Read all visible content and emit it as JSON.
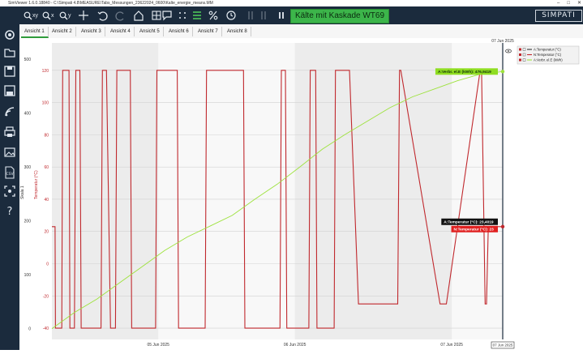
{
  "title_bar": {
    "text": "SimViewer 1.6.0.18840 - C:\\Simpati 4.8\\MEASURE\\Tabs_Messungen_23622024_0600\\Kalte_energie_means.MM"
  },
  "toolbar": {
    "zoom_xy": "xy",
    "zoom_x": "x",
    "zoom_y": "y",
    "kaskade_button": "Kälte mit Kaskade WT69",
    "logo": "SIMPATI"
  },
  "tabs": [
    {
      "label": "Ansicht 1"
    },
    {
      "label": "Ansicht 2"
    },
    {
      "label": "Ansicht 3"
    },
    {
      "label": "Ansicht 4"
    },
    {
      "label": "Ansicht 5"
    },
    {
      "label": "Ansicht 6"
    },
    {
      "label": "Ansicht 7"
    },
    {
      "label": "Ansicht 8"
    }
  ],
  "chart_data": {
    "type": "line",
    "top_date_label": "07 Jun 2025",
    "cursor_date_label": "07 Jun 2025",
    "axes": {
      "scale1": {
        "label": "Skala 1",
        "ticks": [
          "500",
          "400",
          "300",
          "200",
          "100",
          "0"
        ],
        "range": [
          -20,
          530
        ]
      },
      "temperature": {
        "label": "Temperatur (°C)",
        "ticks": [
          "120",
          "100",
          "80",
          "60",
          "40",
          "20",
          "0",
          "-20",
          "-40"
        ],
        "range": [
          -47,
          137
        ]
      }
    },
    "x_ticks": [
      "05 Jun 2025",
      "06 Jun 2025",
      "07 Jun 2025"
    ],
    "legend": [
      {
        "label": "A:Temperatur (°C)",
        "color": "#333333"
      },
      {
        "label": "N:Temperatur (°C)",
        "color": "#c0282d"
      },
      {
        "label": "A:Verbr. el.E (kWh)",
        "color": "#9de23c"
      }
    ],
    "cursor_labels": {
      "verbr": "A:Verbr. el.E (kWh): 476,9419",
      "a_temp": "A:Temperatur (°C): 23,4019",
      "n_temp": "N:Temperatur (°C): 23"
    },
    "series": [
      {
        "name": "N:Temperatur (°C)",
        "color": "#c0282d",
        "x": [
          0.0,
          0.007,
          0.008,
          0.014,
          0.016,
          0.022,
          0.024,
          0.038,
          0.04,
          0.05,
          0.053,
          0.062,
          0.065,
          0.071,
          0.073,
          0.109,
          0.112,
          0.118,
          0.121,
          0.13,
          0.133,
          0.141,
          0.144,
          0.174,
          0.177,
          0.196,
          0.199,
          0.205,
          0.208,
          0.23,
          0.233,
          0.278,
          0.281,
          0.306,
          0.309,
          0.324,
          0.327,
          0.34,
          0.343,
          0.425,
          0.428,
          0.435,
          0.438,
          0.506,
          0.509,
          0.518,
          0.521,
          0.531,
          0.534,
          0.547,
          0.55,
          0.57,
          0.573,
          0.585,
          0.588,
          0.604,
          0.607,
          0.626,
          0.629,
          0.657,
          0.66,
          0.68,
          0.683,
          0.764,
          0.767,
          0.771,
          0.774,
          0.861,
          0.864,
          0.872,
          0.875,
          0.95,
          0.953,
          0.961,
          0.964,
          0.968,
          1.0
        ],
        "y": [
          23,
          23,
          -40,
          -40,
          -40,
          -40,
          120,
          120,
          -40,
          -40,
          120,
          120,
          -40,
          -40,
          -40,
          -40,
          120,
          120,
          120,
          -40,
          -40,
          -40,
          120,
          120,
          -40,
          -40,
          -40,
          -40,
          -40,
          -40,
          120,
          120,
          -40,
          -40,
          -40,
          -40,
          -40,
          -40,
          120,
          120,
          -40,
          -40,
          -40,
          -40,
          120,
          120,
          -40,
          -40,
          -40,
          -40,
          -40,
          -40,
          120,
          120,
          -40,
          -40,
          -40,
          -40,
          120,
          120,
          120,
          -25,
          -25,
          -25,
          -25,
          120,
          120,
          -25,
          -25,
          -25,
          -25,
          120,
          120,
          -25,
          -25,
          23,
          23
        ]
      },
      {
        "name": "A:Verbr. el.E (kWh)",
        "color": "#9de23c",
        "x": [
          0.0,
          0.02,
          0.05,
          0.1,
          0.15,
          0.2,
          0.25,
          0.3,
          0.35,
          0.4,
          0.45,
          0.5,
          0.55,
          0.6,
          0.65,
          0.7,
          0.75,
          0.8,
          0.85,
          0.9,
          0.95,
          1.0
        ],
        "y": [
          0,
          12,
          30,
          55,
          85,
          115,
          145,
          170,
          190,
          210,
          240,
          268,
          300,
          333,
          360,
          385,
          410,
          430,
          445,
          460,
          472,
          476.94
        ]
      }
    ]
  }
}
